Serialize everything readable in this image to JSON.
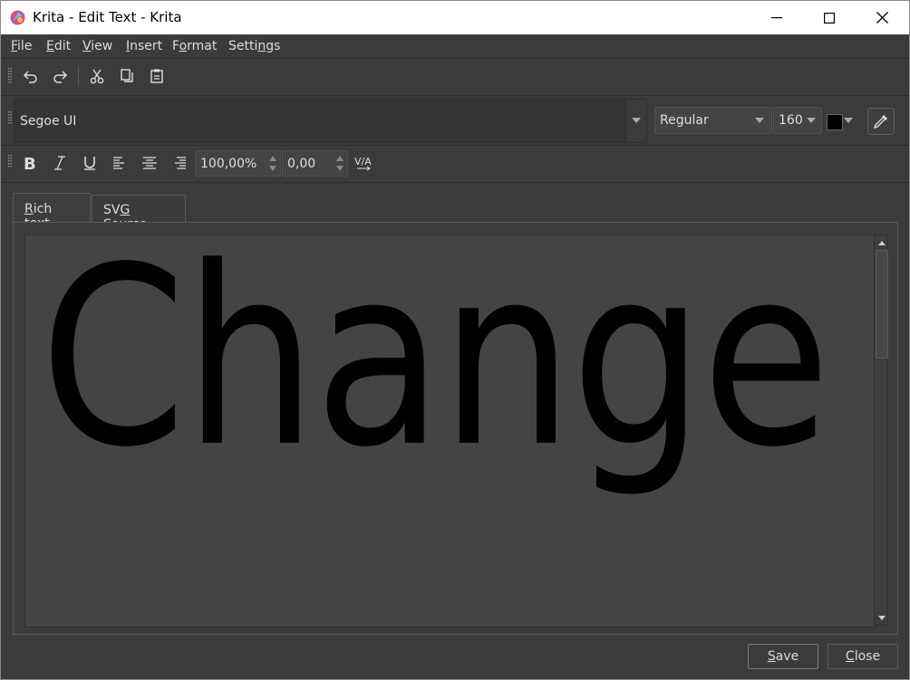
{
  "window": {
    "title": "Krita - Edit Text - Krita",
    "controls": {
      "minimize": "minimize",
      "maximize": "maximize",
      "close": "close"
    }
  },
  "menu": [
    {
      "label_u": "F",
      "label_rest": "ile"
    },
    {
      "label_u": "E",
      "label_rest": "dit"
    },
    {
      "label_u": "V",
      "label_rest": "iew"
    },
    {
      "label_u": "I",
      "label_rest": "nsert"
    },
    {
      "label_pre": "F",
      "label_u": "o",
      "label_rest": "rmat"
    },
    {
      "label_pre": "Setti",
      "label_u": "n",
      "label_rest": "gs"
    }
  ],
  "edit_toolbar": {
    "icons": [
      "undo-icon",
      "redo-icon",
      "cut-icon",
      "copy-icon",
      "paste-icon"
    ]
  },
  "font_toolbar": {
    "font_family": "Segoe UI",
    "font_style": "Regular",
    "font_size": "160",
    "text_color": "#000000"
  },
  "format_toolbar": {
    "icons": [
      "bold-icon",
      "italic-icon",
      "underline-icon",
      "align-left-icon",
      "align-center-icon",
      "align-right-icon",
      "kerning-icon"
    ],
    "line_height": "100,00%",
    "letter_spacing": "0,00",
    "kerning_label": "V/A"
  },
  "tabs": [
    {
      "label_u": "R",
      "label_rest": "ich text",
      "active": true
    },
    {
      "label_pre": "SV",
      "label_u": "G",
      "label_rest": " Source",
      "active": false
    }
  ],
  "editor": {
    "content": "Change",
    "text_color": "#000000",
    "background": "#444444"
  },
  "buttons": {
    "save": {
      "label_u": "S",
      "label_rest": "ave"
    },
    "close": {
      "label_u": "C",
      "label_rest": "lose"
    }
  }
}
